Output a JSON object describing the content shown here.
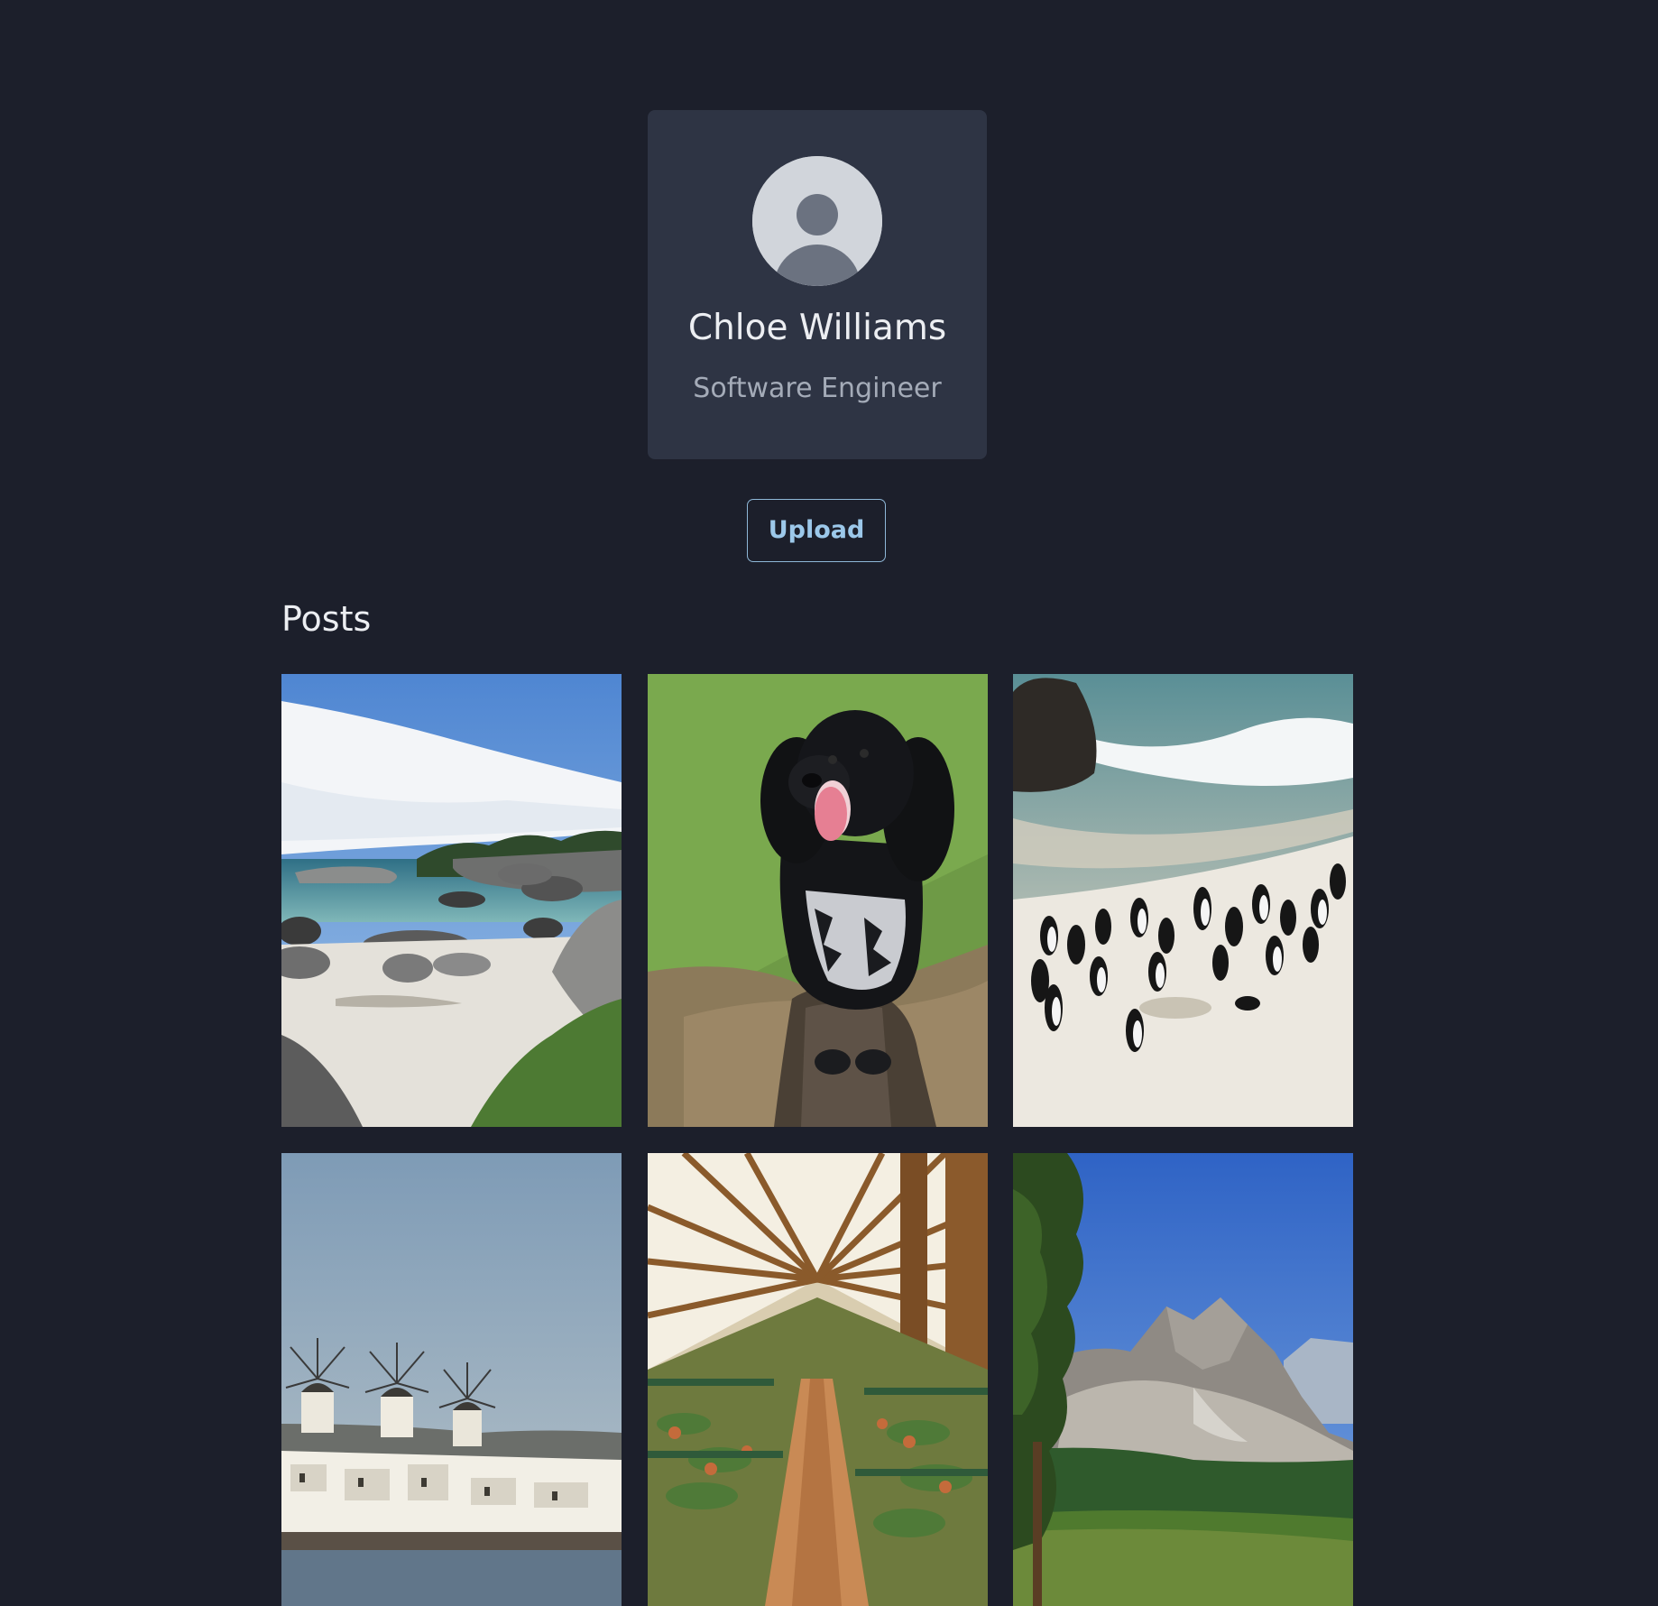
{
  "profile": {
    "name": "Chloe Williams",
    "role": "Software Engineer",
    "avatar_icon": "default-user-silhouette"
  },
  "actions": {
    "upload_label": "Upload"
  },
  "posts": {
    "heading": "Posts",
    "items": [
      {
        "subject": "rocky-beach-photo"
      },
      {
        "subject": "spaniel-dog-photo"
      },
      {
        "subject": "penguins-beach-photo"
      },
      {
        "subject": "windmills-village-photo"
      },
      {
        "subject": "greenhouse-plants-photo"
      },
      {
        "subject": "mountain-landscape-photo"
      }
    ]
  },
  "colors": {
    "background": "#1c1f2b",
    "card": "#2e3444",
    "accent": "#9cc8ea"
  }
}
